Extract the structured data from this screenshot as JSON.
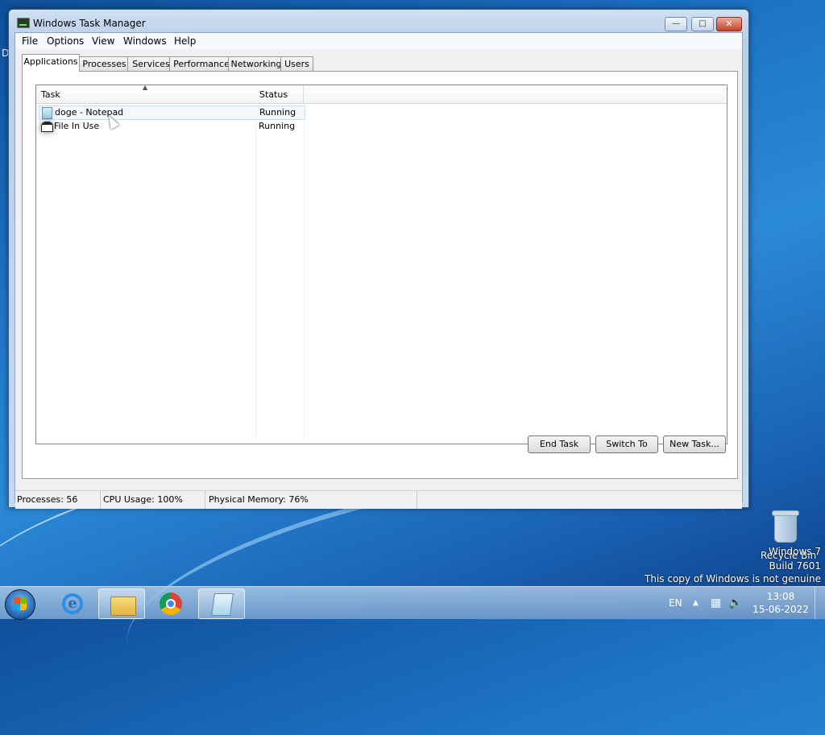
{
  "desktop": {
    "partial_label": "D",
    "recycle_bin": "Recycle Bin",
    "watermark": [
      "Windows 7",
      "Build 7601",
      "This copy of Windows is not genuine"
    ]
  },
  "window": {
    "title": "Windows Task Manager",
    "menu": [
      "File",
      "Options",
      "View",
      "Windows",
      "Help"
    ],
    "tabs": [
      "Applications",
      "Processes",
      "Services",
      "Performance",
      "Networking",
      "Users"
    ],
    "active_tab": "Applications",
    "columns": {
      "task": "Task",
      "status": "Status"
    },
    "rows": [
      {
        "task": "doge - Notepad",
        "status": "Running",
        "icon": "notepad-icon"
      },
      {
        "task": "File In Use",
        "status": "Running",
        "icon": "window-icon"
      }
    ],
    "buttons": {
      "end_task": "End Task",
      "switch_to": "Switch To",
      "new_task": "New Task..."
    },
    "statusbar": {
      "processes": "Processes: 56",
      "cpu": "CPU Usage: 100%",
      "memory": "Physical Memory: 76%"
    }
  },
  "taskbar": {
    "items": [
      "start-orb",
      "internet-explorer",
      "windows-explorer",
      "google-chrome",
      "notepad"
    ],
    "language": "EN",
    "time": "13:08",
    "date": "15-06-2022"
  }
}
